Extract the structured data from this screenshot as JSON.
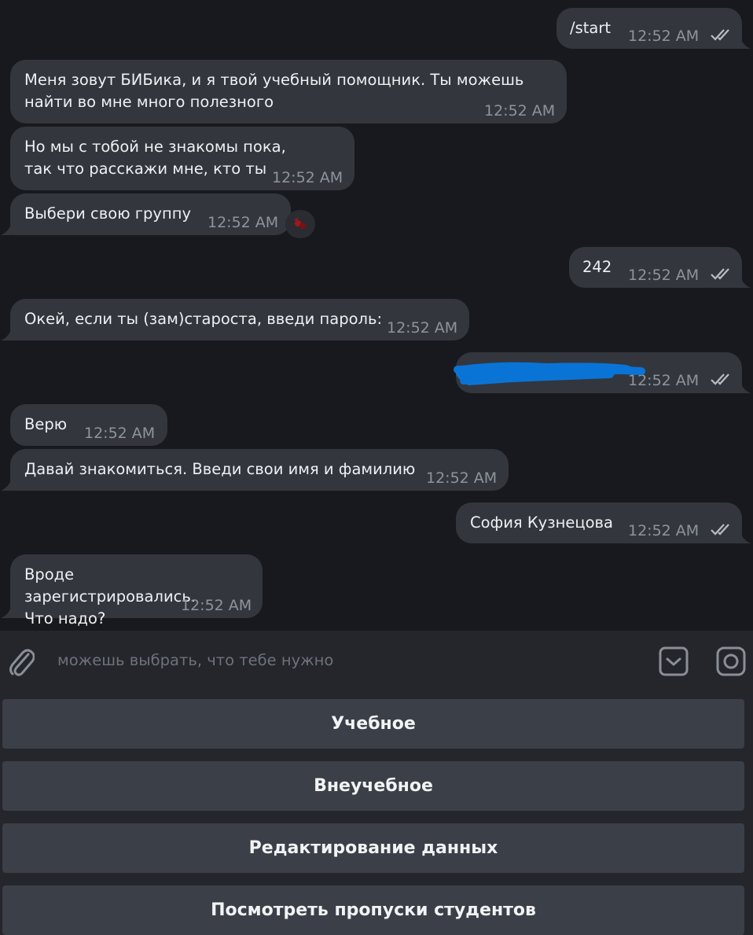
{
  "messages": [
    {
      "dir": "out",
      "text": "/start",
      "time": "12:52 AM",
      "read": true
    },
    {
      "dir": "in",
      "text": "Меня зовут БИБика, и я твой учебный помощник. Ты можешь\nнайти во мне много полезного",
      "time": "12:52 AM"
    },
    {
      "dir": "in",
      "text": "Но мы с тобой не знакомы пока,\nтак что расскажи мне, кто ты",
      "time": "12:52 AM"
    },
    {
      "dir": "in",
      "text": "Выбери свою группу",
      "time": "12:52 AM"
    },
    {
      "dir": "out",
      "text": "242",
      "time": "12:52 AM",
      "read": true
    },
    {
      "dir": "in",
      "text": "Окей, если ты (зам)староста, введи пароль:",
      "time": "12:52 AM"
    },
    {
      "dir": "out",
      "text": "",
      "time": "12:52 AM",
      "read": true,
      "redacted": true
    },
    {
      "dir": "in",
      "text": "Верю",
      "time": "12:52 AM"
    },
    {
      "dir": "in",
      "text": "Давай знакомиться. Введи свои имя и фамилию",
      "time": "12:52 AM"
    },
    {
      "dir": "out",
      "text": "София Кузнецова",
      "time": "12:52 AM",
      "read": true
    },
    {
      "dir": "in",
      "text": "Вроде зарегистрировались.\nЧто надо?",
      "time": "12:52 AM"
    }
  ],
  "composer": {
    "placeholder": "можешь выбрать, что тебе нужно",
    "icons": [
      "paperclip-icon",
      "bot-keyboard-icon",
      "camera-icon"
    ]
  },
  "keyboard": {
    "buttons": [
      "Учебное",
      "Внеучебное",
      "Редактирование данных",
      "Посмотреть пропуски студентов"
    ]
  },
  "colors": {
    "background": "#18191e",
    "bubble": "#33363d",
    "panel": "#24262c",
    "button": "#3b3f47",
    "redaction": "#0a74d6"
  }
}
